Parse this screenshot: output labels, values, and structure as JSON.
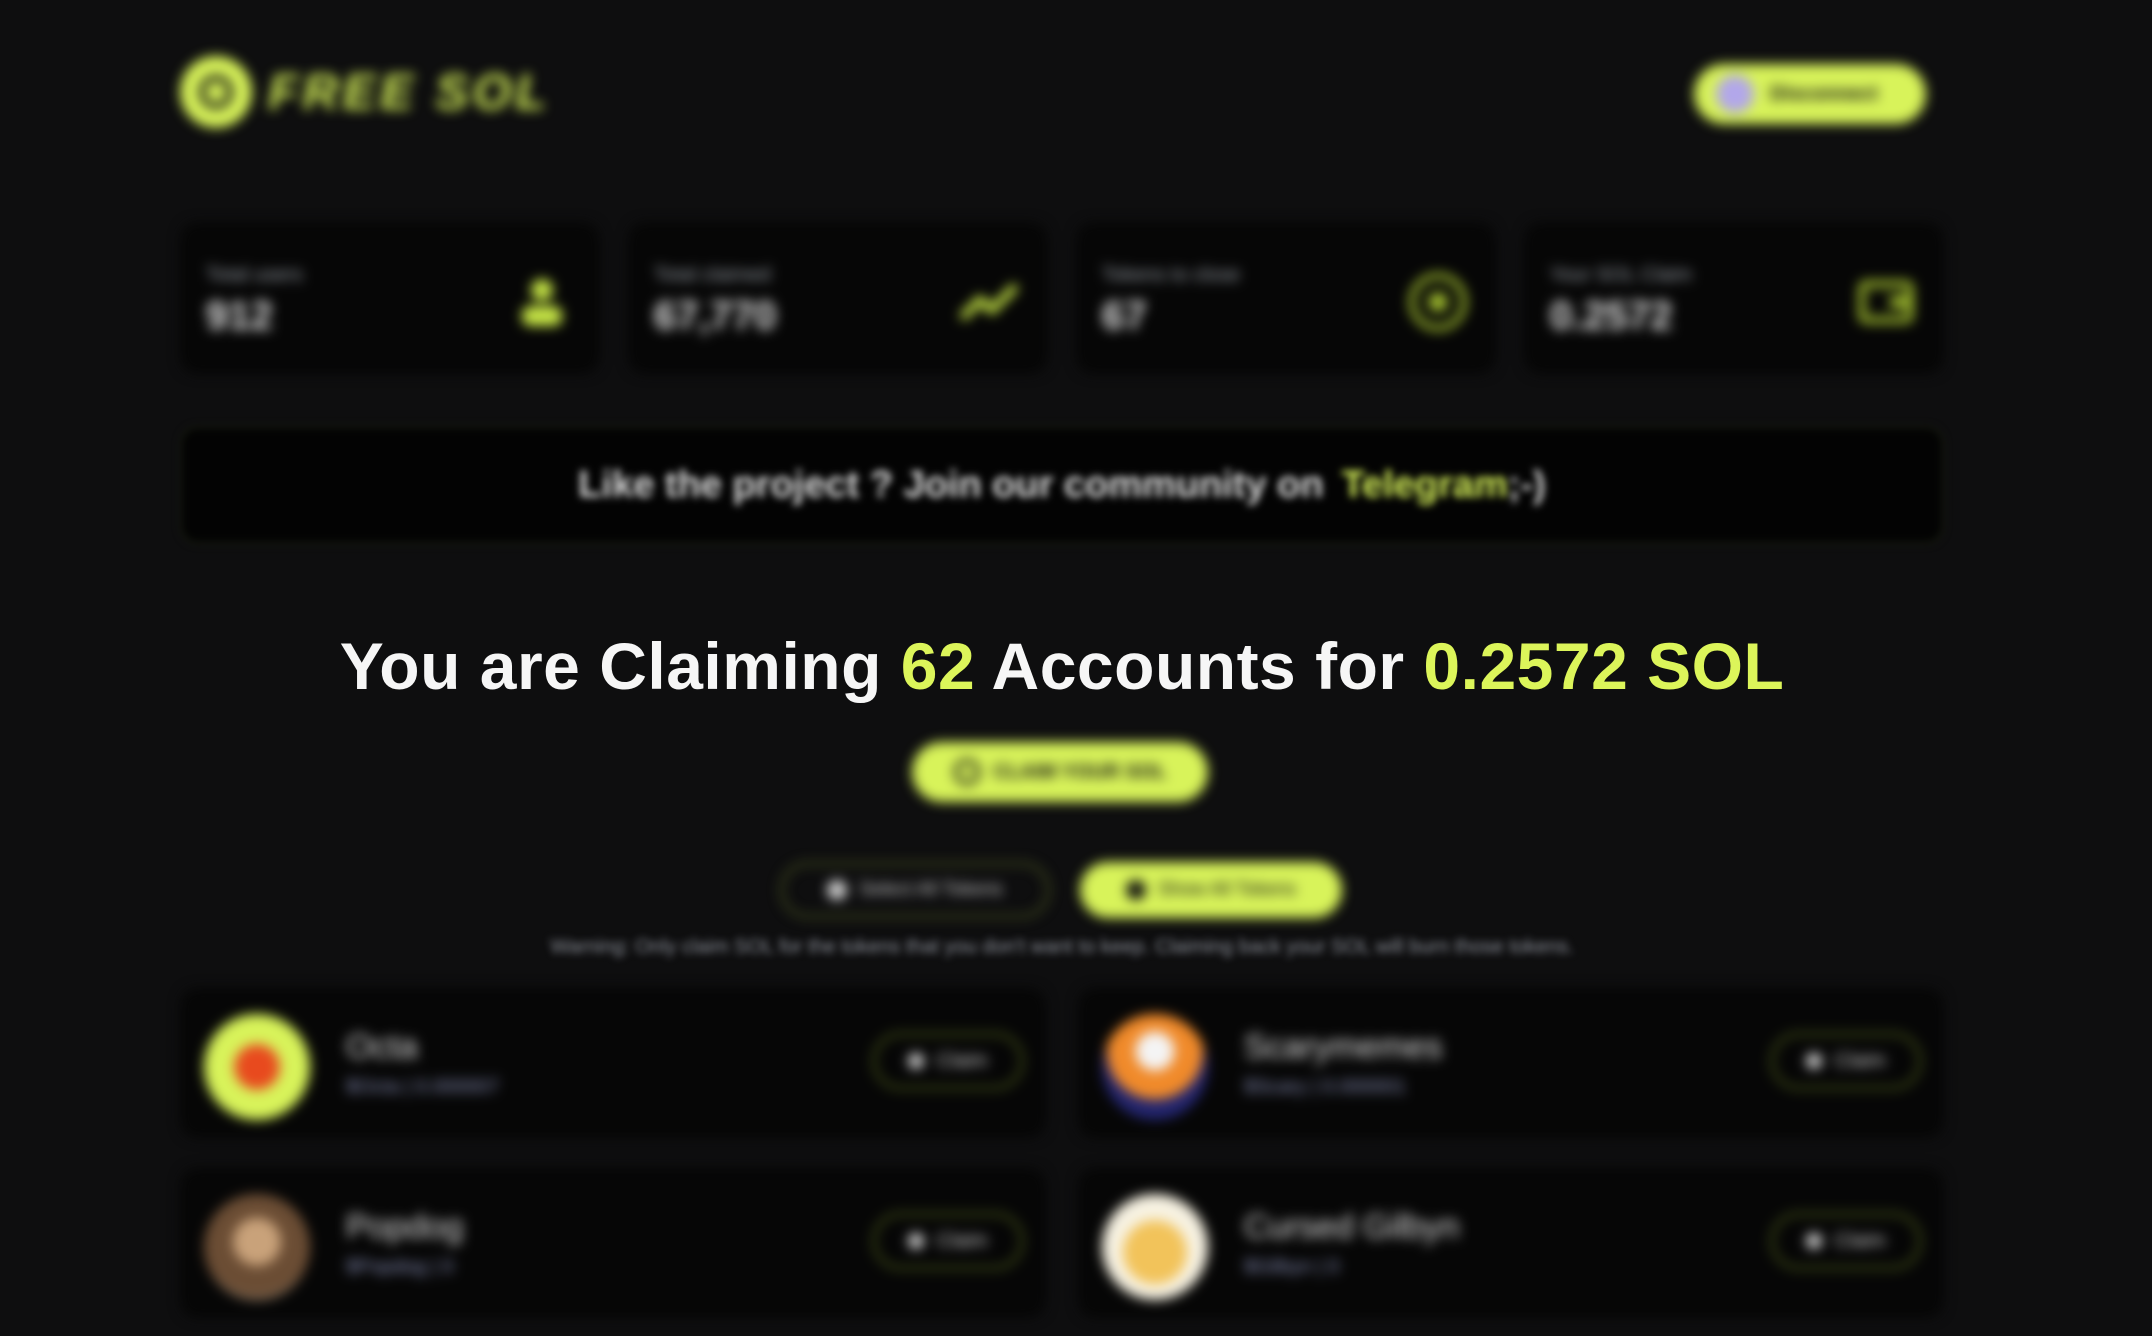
{
  "header": {
    "logo_text": "FREE SOL",
    "disconnect_label": "Disconnect"
  },
  "stats": [
    {
      "label": "Total users",
      "value": "912",
      "icon": "users-icon"
    },
    {
      "label": "Total claimed",
      "value": "67,770",
      "icon": "trend-icon"
    },
    {
      "label": "Tokens to close",
      "value": "67",
      "icon": "coin-icon"
    },
    {
      "label": "Your SOL Claim",
      "value": "0.2572",
      "icon": "wallet-icon"
    }
  ],
  "community": {
    "text": "Like the project ? Join our community on",
    "link": "Telegram",
    "suffix": " ;-)"
  },
  "headline": {
    "prefix": "You are Claiming ",
    "accounts": "62",
    "middle": " Accounts for ",
    "amount": "0.2572 SOL"
  },
  "actions": {
    "claim_label": "CLAIM YOUR SOL",
    "select_all_label": "Select All Tokens",
    "show_all_label": "Show All Tokens"
  },
  "warning": "Warning: Only claim SOL for the tokens that you don't want to keep. Claiming back your SOL will burn those tokens.",
  "tokens": [
    {
      "name": "Octa",
      "sub": "$Octa | 0.000007",
      "claim": "Claim",
      "color": "#d8f35a"
    },
    {
      "name": "Scarymemes",
      "sub": "$Scary | 0.000001",
      "claim": "Claim",
      "color": "#f08a2a"
    },
    {
      "name": "Popdog",
      "sub": "$Popdog | 0",
      "claim": "Claim",
      "color": "#8a6a4a"
    },
    {
      "name": "Cursed Gilbyn",
      "sub": "$Gilbyn | 0",
      "claim": "Claim",
      "color": "#f2c35a"
    }
  ],
  "colors": {
    "accent": "#d8f35a",
    "background": "#0e0e0f",
    "card": "#060606"
  }
}
